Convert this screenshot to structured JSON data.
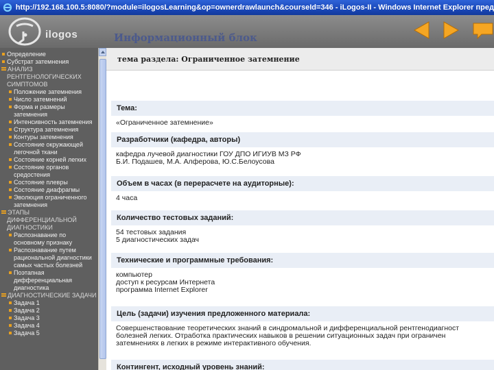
{
  "window": {
    "title": "http://192.168.100.5:8080/?module=ilogosLearning&op=ownerdrawlaunch&courseId=346 - iLogos-II - Windows Internet Explorer предос"
  },
  "header": {
    "logo_text": "ilogos"
  },
  "sidebar": {
    "items": [
      {
        "type": "l1",
        "label": "Определение"
      },
      {
        "type": "l1",
        "label": "Субстрат затемнения"
      },
      {
        "type": "cat",
        "label": "АНАЛИЗ РЕНТГЕНОЛОГИЧЕСКИХ СИМПТОМОВ"
      },
      {
        "type": "l2",
        "label": "Положение затемнения"
      },
      {
        "type": "l2",
        "label": "Число затемнений"
      },
      {
        "type": "l2",
        "label": "Форма и размеры затемнения"
      },
      {
        "type": "l2",
        "label": "Интенсивность затемнения"
      },
      {
        "type": "l2",
        "label": "Структура затемнения"
      },
      {
        "type": "l2",
        "label": "Контуры затемнения"
      },
      {
        "type": "l2",
        "label": "Состояние окружающей легочной ткани"
      },
      {
        "type": "l2",
        "label": "Состояние корней легких"
      },
      {
        "type": "l2",
        "label": "Состояние органов средостения"
      },
      {
        "type": "l2",
        "label": "Состояние плевры"
      },
      {
        "type": "l2",
        "label": "Состояние диафрагмы"
      },
      {
        "type": "l2",
        "label": "Эволюция ограниченного затемнения"
      },
      {
        "type": "cat",
        "label": "ЭТАПЫ ДИФФЕРЕНЦИАЛЬНОЙ ДИАГНОСТИКИ"
      },
      {
        "type": "l2",
        "label": "Распознавание по основному признаку"
      },
      {
        "type": "l2",
        "label": "Распознавание путем рациональной диагностики самых частых болезней"
      },
      {
        "type": "l2",
        "label": "Поэтапная дифференциальная диагностика"
      },
      {
        "type": "cat",
        "label": "ДИАГНОСТИЧЕСКИЕ ЗАДАЧИ"
      },
      {
        "type": "l2",
        "label": "Задача 1"
      },
      {
        "type": "l2",
        "label": "Задача 2"
      },
      {
        "type": "l2",
        "label": "Задача 3"
      },
      {
        "type": "l2",
        "label": "Задача 4"
      },
      {
        "type": "l2",
        "label": "Задача 5"
      }
    ]
  },
  "main": {
    "section_title": "тема раздела: Ограниченное затемнение",
    "info_title": "Информационный блок",
    "fields": [
      {
        "label": "Тема:",
        "lines": [
          "«Ограниченное затемнение»"
        ]
      },
      {
        "label": "Разработчики (кафедра, авторы)",
        "lines": [
          "кафедра лучевой диагностики ГОУ ДПО ИГИУВ МЗ РФ",
          "Б.И. Подашев, М.А. Алферова, Ю.С.Белоусова"
        ]
      },
      {
        "label": "Объем в часах (в перерасчете на  аудиторные):",
        "lines": [
          "4 часа"
        ]
      },
      {
        "label": "Количество  тестовых заданий:",
        "lines": [
          "54 тестовых задания",
          "5 диагностических задач"
        ]
      },
      {
        "label": "Технические и программные требования:",
        "lines": [
          "компьютер",
          "доступ к ресурсам Интернета",
          "программа Internet Explorer"
        ]
      },
      {
        "label": "Цель (задачи) изучения предложенного материала:",
        "lines": [
          "Совершенствование теоретических знаний в синдромальной и дифференциальной рентгенодиагност",
          "болезней легких. Отработка практических навыков в решении ситуационных задач при ограничен",
          "затемнениях в легких в режиме интерактивного обучения."
        ]
      },
      {
        "label": "Контингент, исходный  уровень знаний:",
        "lines": []
      }
    ]
  }
}
